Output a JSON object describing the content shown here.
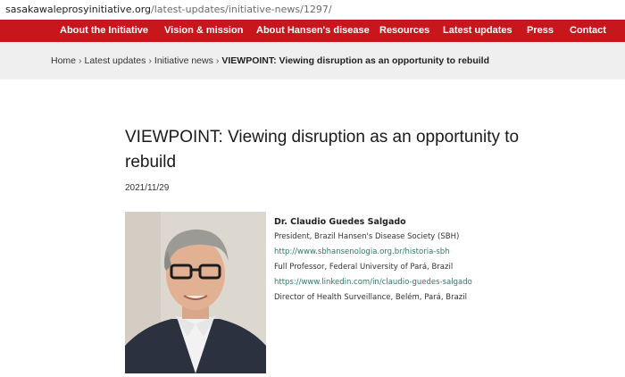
{
  "browser": {
    "url_host": "sasakawaleprosyinitiative.org",
    "url_path": "/latest-updates/initiative-news/1297/"
  },
  "nav": {
    "items": [
      "About the Initiative",
      "Vision & mission",
      "About Hansen's disease",
      "Resources",
      "Latest updates",
      "Press",
      "Contact"
    ]
  },
  "breadcrumb": {
    "home": "Home",
    "latest": "Latest updates",
    "news": "Initiative news",
    "current": "VIEWPOINT: Viewing disruption as an opportunity to rebuild",
    "separator": "›"
  },
  "article": {
    "title": "VIEWPOINT: Viewing disruption as an opportunity to rebuild",
    "date": "2021/11/29"
  },
  "author": {
    "name": "Dr. Claudio Guedes Salgado",
    "role1": "President, Brazil Hansen's Disease Society (SBH)",
    "link1": "http://www.sbhansenologia.org.br/historia-sbh",
    "role2": "Full Professor, Federal University of Pará, Brazil",
    "link2": "https://www.linkedin.com/in/claudio-guedes-salgado",
    "role3": "Director of Health Surveillance, Belém, Pará, Brazil"
  },
  "colors": {
    "nav_bg": "#c8161d",
    "crumb_bg": "#efefef",
    "link": "#2a7a6a"
  }
}
